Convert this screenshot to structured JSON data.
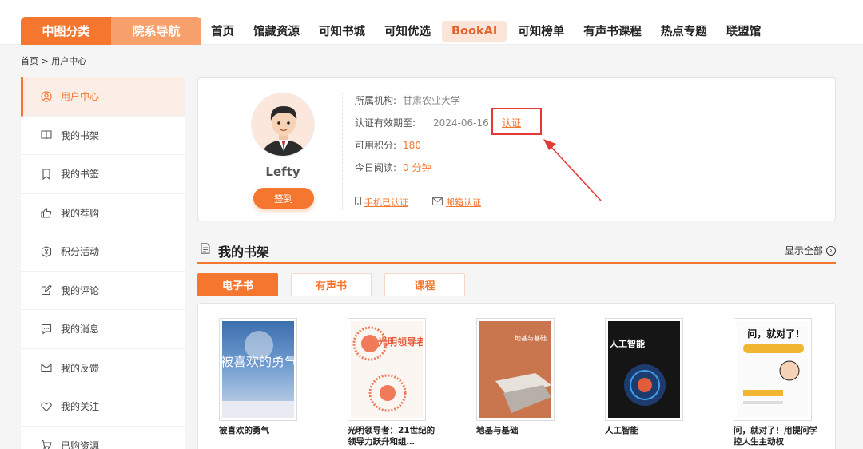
{
  "nav": {
    "primary": "中图分类",
    "secondary": "院系导航",
    "links": [
      "首页",
      "馆藏资源",
      "可知书城",
      "可知优选",
      "BookAI",
      "可知榜单",
      "有声书课程",
      "热点专题",
      "联盟馆"
    ]
  },
  "breadcrumb": "首页 > 用户中心",
  "sidebar": {
    "items": [
      {
        "label": "用户中心",
        "icon": "user-circle-icon"
      },
      {
        "label": "我的书架",
        "icon": "book-open-icon"
      },
      {
        "label": "我的书签",
        "icon": "bookmark-icon"
      },
      {
        "label": "我的荐购",
        "icon": "thumb-up-icon"
      },
      {
        "label": "积分活动",
        "icon": "yen-badge-icon"
      },
      {
        "label": "我的评论",
        "icon": "edit-icon"
      },
      {
        "label": "我的消息",
        "icon": "message-icon"
      },
      {
        "label": "我的反馈",
        "icon": "mail-icon"
      },
      {
        "label": "我的关注",
        "icon": "heart-icon"
      },
      {
        "label": "已购资源",
        "icon": "cart-icon"
      }
    ]
  },
  "profile": {
    "username": "Lefty",
    "signin": "签到",
    "org_label": "所属机构:",
    "org_value": "甘肃农业大学",
    "expiry_label": "认证有效期至:",
    "expiry_value": "2024-06-16",
    "verify": "认证",
    "points_label": "可用积分:",
    "points_value": "180",
    "reading_label": "今日阅读:",
    "reading_value": "0 分钟",
    "phone_verified": "手机已认证",
    "email_verify": "邮箱认证"
  },
  "shelf": {
    "title": "我的书架",
    "show_all": "显示全部",
    "tabs": [
      "电子书",
      "有声书",
      "课程"
    ],
    "books": [
      {
        "title": "被喜欢的勇气",
        "cover_title": "被喜欢的勇气"
      },
      {
        "title": "光明领导者：21世纪的领导力跃升和组…",
        "cover_title": "光明领导者"
      },
      {
        "title": "地基与基础",
        "cover_title": "地基与基础"
      },
      {
        "title": "人工智能",
        "cover_title": "人工智能"
      },
      {
        "title": "问，就对了！用提问学控人生主动权",
        "cover_title": "问，就对了!"
      }
    ]
  },
  "colors": {
    "accent": "#f5762f",
    "accent_light": "#f7a06b",
    "highlight": "#e53935"
  }
}
